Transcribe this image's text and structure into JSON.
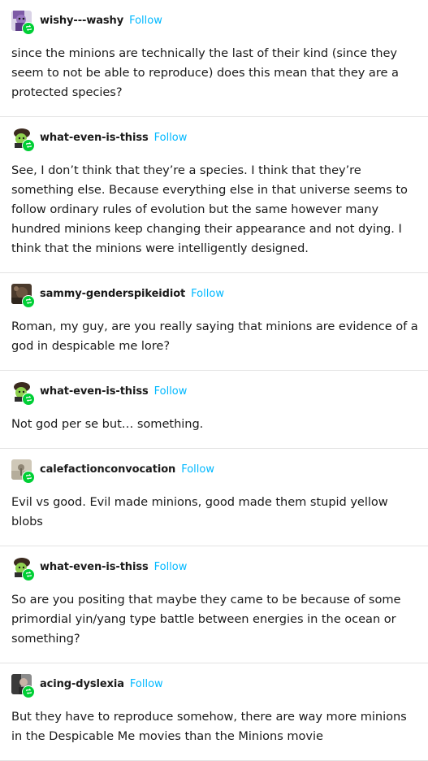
{
  "posts": [
    {
      "username": "wishy---washy",
      "follow_label": "Follow",
      "avatar_icon": "avatar-purple-character",
      "body": "since the minions are technically the last of their kind (since they seem to not be able to reproduce) does this mean that they are a protected species?"
    },
    {
      "username": "what-even-is-thiss",
      "follow_label": "Follow",
      "avatar_icon": "avatar-green-character",
      "body": "See, I don’t think that they’re a species. I think that they’re something else. Because everything else in that universe seems to follow ordinary rules of evolution but the same however many hundred minions keep changing their appearance and not dying. I think that the minions were intelligently designed."
    },
    {
      "username": "sammy-genderspikeidiot",
      "follow_label": "Follow",
      "avatar_icon": "avatar-brown-photo",
      "body": "Roman, my guy, are you really saying that minions are evidence of a god in despicable me lore?"
    },
    {
      "username": "what-even-is-thiss",
      "follow_label": "Follow",
      "avatar_icon": "avatar-green-character",
      "body": "Not god per se but… something."
    },
    {
      "username": "calefactionconvocation",
      "follow_label": "Follow",
      "avatar_icon": "avatar-beige-photo",
      "body": "Evil vs good. Evil made minions, good made them stupid yellow blobs"
    },
    {
      "username": "what-even-is-thiss",
      "follow_label": "Follow",
      "avatar_icon": "avatar-green-character",
      "body": "So are you positing that maybe they came to be because of some primordial yin/yang type battle between energies in the ocean or something?"
    },
    {
      "username": "acing-dyslexia",
      "follow_label": "Follow",
      "avatar_icon": "avatar-dark-photo",
      "body": "But they have to reproduce somehow, there are way more minions in the Despicable Me movies than the Minions movie"
    }
  ],
  "colors": {
    "follow": "#00b8ff",
    "reblog_badge": "#00cf35",
    "divider": "#e3e3e3"
  },
  "icons": {
    "reblog": "reblog-icon"
  }
}
